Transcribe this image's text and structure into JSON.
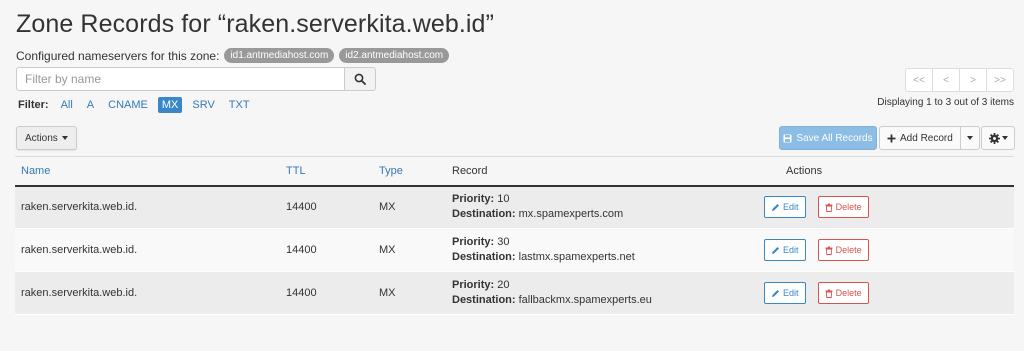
{
  "header": {
    "title": "Zone Records for “raken.serverkita.web.id”",
    "nameservers_label": "Configured nameservers for this zone:",
    "nameservers": [
      "id1.antmediahost.com",
      "id2.antmediahost.com"
    ]
  },
  "search": {
    "placeholder": "Filter by name",
    "value": ""
  },
  "filter": {
    "label": "Filter:",
    "options": [
      "All",
      "A",
      "CNAME",
      "MX",
      "SRV",
      "TXT"
    ],
    "active": "MX"
  },
  "pagination": {
    "buttons": [
      "<<",
      "<",
      ">",
      ">>"
    ],
    "displaying": "Displaying 1 to 3 out of 3 items"
  },
  "toolbar": {
    "actions_label": "Actions",
    "save_label": "Save All Records",
    "add_label": "Add Record"
  },
  "table": {
    "headers": [
      "Name",
      "TTL",
      "Type",
      "Record",
      "Actions"
    ],
    "rows": [
      {
        "name": "raken.serverkita.web.id.",
        "ttl": "14400",
        "type": "MX",
        "priority_label": "Priority:",
        "priority": "10",
        "destination_label": "Destination:",
        "destination": "mx.spamexperts.com"
      },
      {
        "name": "raken.serverkita.web.id.",
        "ttl": "14400",
        "type": "MX",
        "priority_label": "Priority:",
        "priority": "30",
        "destination_label": "Destination:",
        "destination": "lastmx.spamexperts.net"
      },
      {
        "name": "raken.serverkita.web.id.",
        "ttl": "14400",
        "type": "MX",
        "priority_label": "Priority:",
        "priority": "20",
        "destination_label": "Destination:",
        "destination": "fallbackmx.spamexperts.eu"
      }
    ],
    "edit_label": "Edit",
    "delete_label": "Delete"
  },
  "colors": {
    "accent": "#337ab7",
    "active_filter": "#3a87c8",
    "danger": "#d9534f",
    "save_disabled": "#8cbde5"
  },
  "icons": {
    "search": "search-icon",
    "save": "floppy-icon",
    "add": "plus-icon",
    "settings": "gear-icon",
    "edit": "pencil-icon",
    "delete": "trash-icon"
  }
}
